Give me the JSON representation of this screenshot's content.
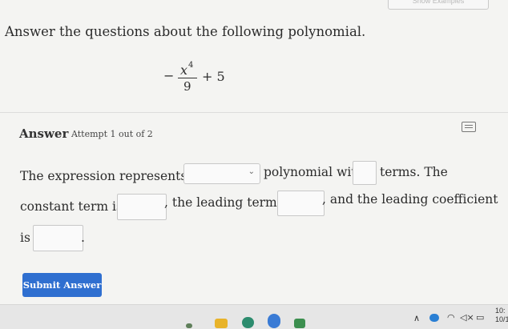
{
  "top_button": {
    "label": "Show Examples"
  },
  "question": {
    "prompt": "Answer the questions about the following polynomial."
  },
  "expression": {
    "minus": "−",
    "numerator_var": "x",
    "exponent": "4",
    "denominator": "9",
    "plus_term": "+ 5"
  },
  "answer": {
    "label": "Answer",
    "attempt": "Attempt 1 out of 2"
  },
  "sentence": {
    "part1": "The expression represents a",
    "part2": "polynomial with",
    "part3": "terms. The",
    "part4": "constant term is",
    "part5": ", the leading term is",
    "part6": ", and the leading coefficient",
    "part7": "is",
    "part8": "."
  },
  "polynomial_type_select": {
    "value": "",
    "chevron": "⌄"
  },
  "submit": {
    "label": "Submit Answer"
  },
  "taskbar": {
    "chevron": "∧",
    "wifi": "◠",
    "volume": "◁×",
    "battery": "▭",
    "clock_time": "10:",
    "clock_date": "10/1"
  },
  "colors": {
    "accent": "#2f6fd0",
    "background": "#f4f4f2"
  }
}
